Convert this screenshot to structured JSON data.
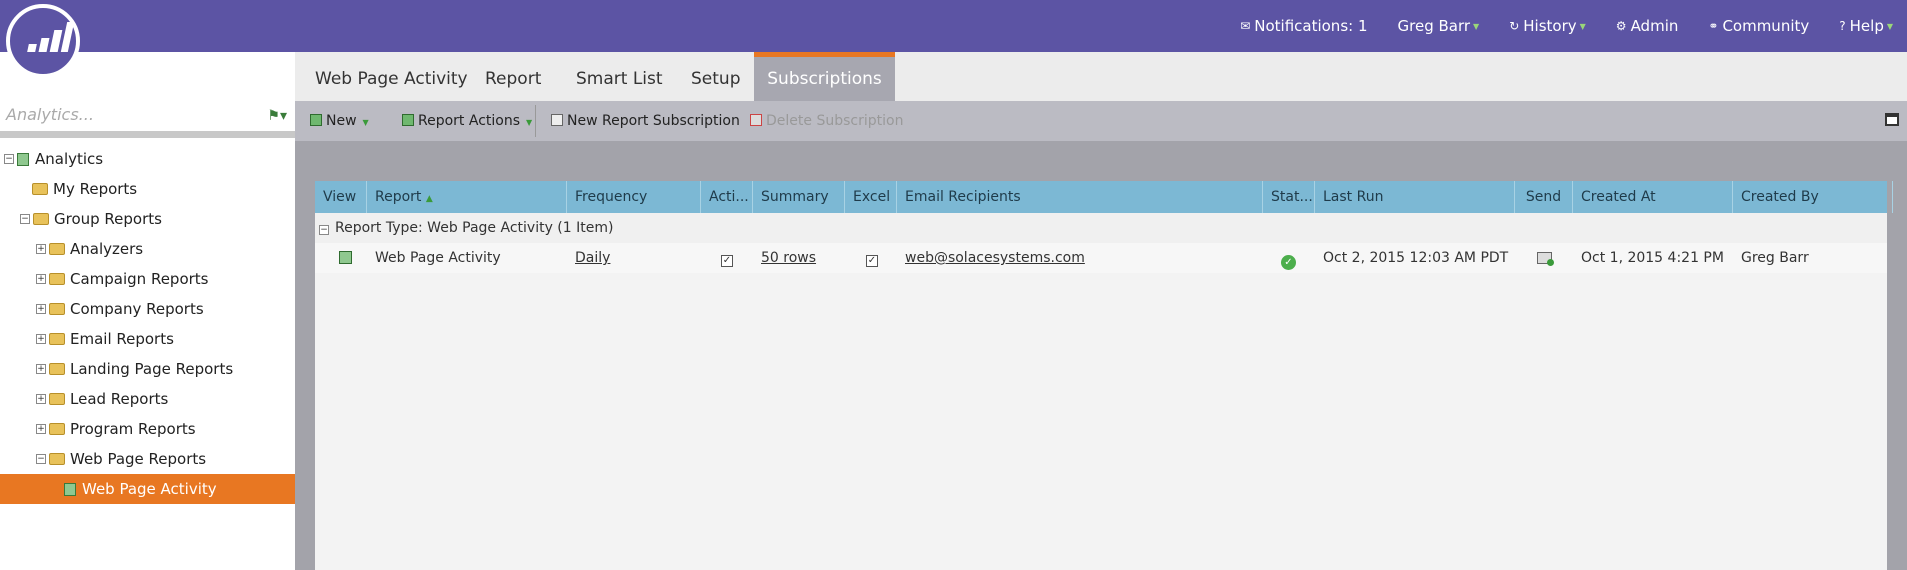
{
  "topnav": {
    "notifications": "Notifications: 1",
    "user": "Greg Barr",
    "history": "History",
    "admin": "Admin",
    "community": "Community",
    "help": "Help"
  },
  "sidebar": {
    "search_placeholder": "Analytics...",
    "tree": {
      "analytics": "Analytics",
      "my_reports": "My Reports",
      "group_reports": "Group Reports",
      "analyzers": "Analyzers",
      "campaign_reports": "Campaign Reports",
      "company_reports": "Company Reports",
      "email_reports": "Email Reports",
      "landing_page_reports": "Landing Page Reports",
      "lead_reports": "Lead Reports",
      "program_reports": "Program Reports",
      "web_page_reports": "Web Page Reports",
      "web_page_activity": "Web Page Activity"
    }
  },
  "tabs": {
    "web_page_activity": "Web Page Activity",
    "report": "Report",
    "smart_list": "Smart List",
    "setup": "Setup",
    "subscriptions": "Subscriptions"
  },
  "toolbar": {
    "new": "New",
    "report_actions": "Report Actions",
    "new_subscription": "New Report Subscription",
    "delete_subscription": "Delete Subscription"
  },
  "grid": {
    "columns": {
      "view": "View",
      "report": "Report",
      "frequency": "Frequency",
      "active": "Acti...",
      "summary": "Summary",
      "excel": "Excel",
      "email_recipients": "Email Recipients",
      "status": "Stat...",
      "last_run": "Last Run",
      "send": "Send",
      "created_at": "Created At",
      "created_by": "Created By"
    },
    "group_label": "Report Type: Web Page Activity (1 Item)",
    "row": {
      "report": "Web Page Activity",
      "frequency": "Daily",
      "summary": "50 rows",
      "email": "web@solacesystems.com",
      "last_run": "Oct 2, 2015 12:03 AM PDT",
      "created_at": "Oct 1, 2015 4:21 PM",
      "created_by": "Greg Barr"
    }
  }
}
